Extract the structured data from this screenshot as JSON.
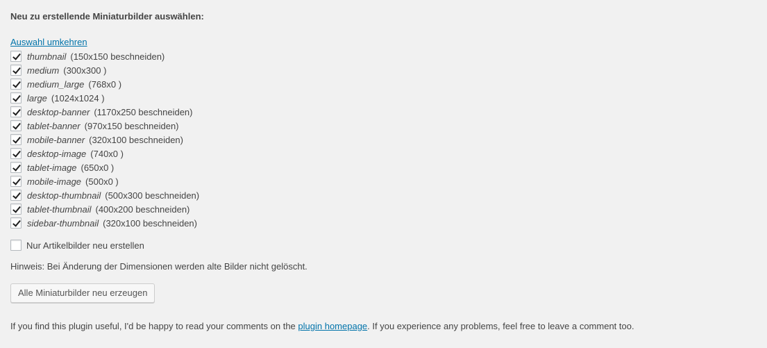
{
  "heading": "Neu zu erstellende Miniaturbilder auswählen:",
  "invert_selection_label": "Auswahl umkehren",
  "sizes": [
    {
      "name": "thumbnail",
      "dims": "(150x150 beschneiden)",
      "checked": true
    },
    {
      "name": "medium",
      "dims": "(300x300 )",
      "checked": true
    },
    {
      "name": "medium_large",
      "dims": "(768x0 )",
      "checked": true
    },
    {
      "name": "large",
      "dims": "(1024x1024 )",
      "checked": true
    },
    {
      "name": "desktop-banner",
      "dims": "(1170x250 beschneiden)",
      "checked": true
    },
    {
      "name": "tablet-banner",
      "dims": "(970x150 beschneiden)",
      "checked": true
    },
    {
      "name": "mobile-banner",
      "dims": "(320x100 beschneiden)",
      "checked": true
    },
    {
      "name": "desktop-image",
      "dims": "(740x0 )",
      "checked": true
    },
    {
      "name": "tablet-image",
      "dims": "(650x0 )",
      "checked": true
    },
    {
      "name": "mobile-image",
      "dims": "(500x0 )",
      "checked": true
    },
    {
      "name": "desktop-thumbnail",
      "dims": "(500x300 beschneiden)",
      "checked": true
    },
    {
      "name": "tablet-thumbnail",
      "dims": "(400x200 beschneiden)",
      "checked": true
    },
    {
      "name": "sidebar-thumbnail",
      "dims": "(320x100 beschneiden)",
      "checked": true
    }
  ],
  "only_featured": {
    "label": "Nur Artikelbilder neu erstellen",
    "checked": false
  },
  "hint": "Hinweis: Bei Änderung der Dimensionen werden alte Bilder nicht gelöscht.",
  "regenerate_button_label": "Alle Miniaturbilder neu erzeugen",
  "footer": {
    "text_before": "If you find this plugin useful, I'd be happy to read your comments on the ",
    "link_text": "plugin homepage",
    "text_after": ". If you experience any problems, feel free to leave a comment too."
  },
  "colors": {
    "background": "#f1f1f1",
    "text": "#444444",
    "link": "#0073aa"
  }
}
